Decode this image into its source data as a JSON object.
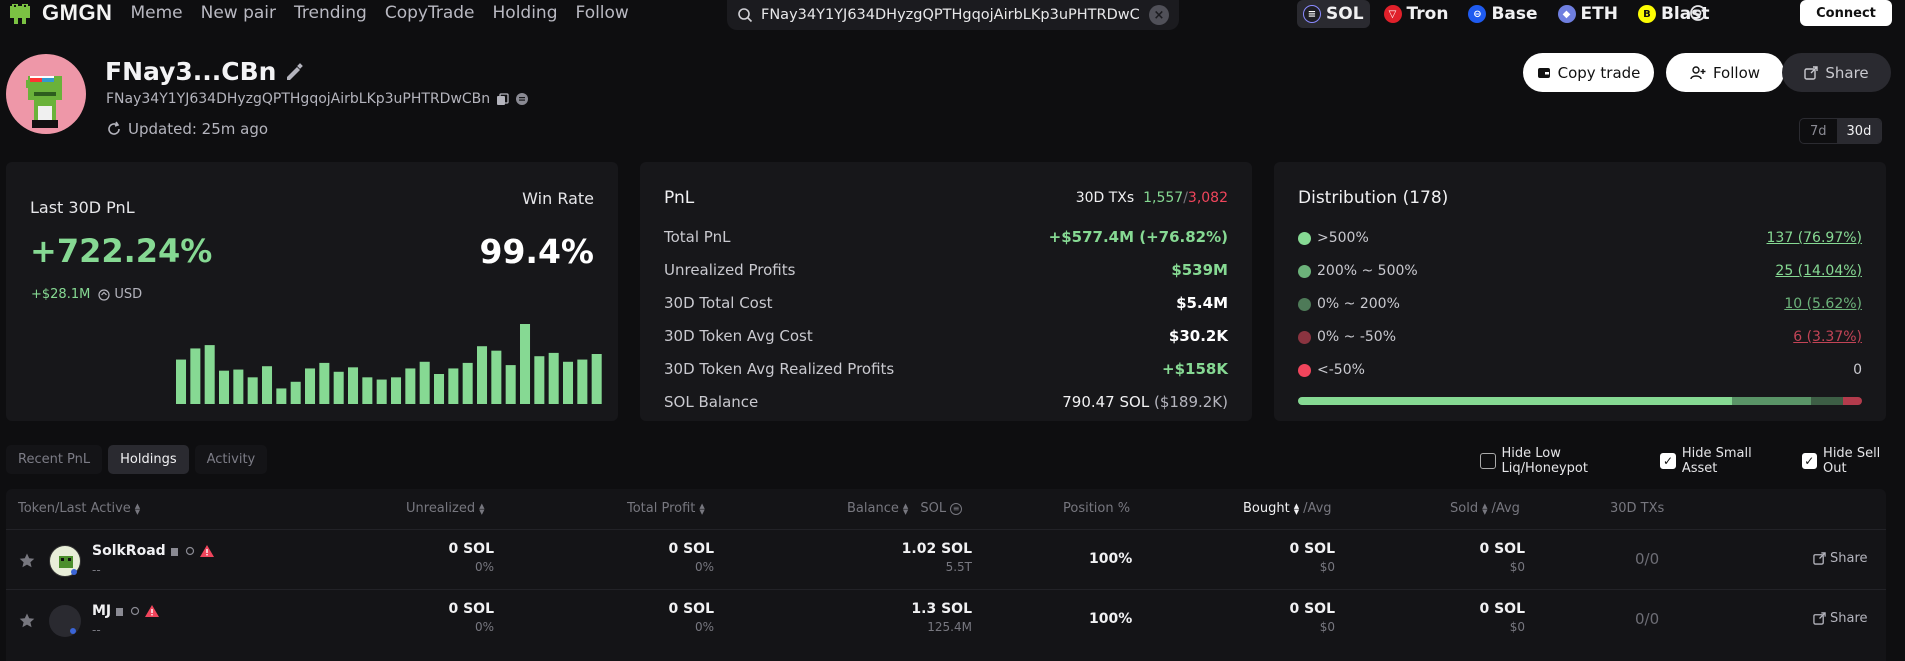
{
  "topbar": {
    "logo_text": "GMGN",
    "nav": [
      "Meme",
      "New pair",
      "Trending",
      "CopyTrade",
      "Holding",
      "Follow"
    ],
    "search_value": "FNay34Y1YJ634DHyzgQPTHgqojAirbLKp3uPHTRDwCBn",
    "chains": [
      {
        "label": "SOL",
        "color": "#1f1f24",
        "active": true
      },
      {
        "label": "Tron",
        "color": "#e0202a"
      },
      {
        "label": "Base",
        "color": "#1f5bf0"
      },
      {
        "label": "ETH",
        "color": "#6f7fe0"
      },
      {
        "label": "Blast",
        "color": "#fcfc03"
      }
    ],
    "connect_label": "Connect"
  },
  "wallet": {
    "name": "FNay3...CBn",
    "address": "FNay34Y1YJ634DHyzgQPTHgqojAirbLKp3uPHTRDwCBn",
    "updated": "Updated: 25m ago",
    "buttons": {
      "copy": "Copy trade",
      "follow": "Follow",
      "share": "Share"
    },
    "periods": [
      "7d",
      "30d"
    ],
    "period_active": "30d"
  },
  "pnl_card": {
    "label": "Last 30D PnL",
    "value": "+722.24%",
    "usd_value": "+$28.1M",
    "usd_label": "USD",
    "winrate_label": "Win Rate",
    "winrate_value": "99.4%",
    "bar_values": [
      40,
      50,
      53,
      30,
      31,
      24,
      34,
      14,
      20,
      32,
      37,
      29,
      33,
      24,
      22,
      24,
      32,
      38,
      27,
      32,
      37,
      52,
      48,
      35,
      72,
      43,
      46,
      38,
      40,
      45
    ]
  },
  "pnl_stats": {
    "title": "PnL",
    "tx_label": "30D TXs",
    "tx_buy": "1,557",
    "tx_sell": "3,082",
    "rows": [
      {
        "k": "Total PnL",
        "v": "+$577.4M (+76.82%)",
        "color": "#86d993"
      },
      {
        "k": "Unrealized Profits",
        "v": "$539M",
        "color": "#86d993"
      },
      {
        "k": "30D Total Cost",
        "v": "$5.4M",
        "color": "#ffffff"
      },
      {
        "k": "30D Token Avg Cost",
        "v": "$30.2K",
        "color": "#ffffff"
      },
      {
        "k": "30D Token Avg Realized Profits",
        "v": "+$158K",
        "color": "#86d993"
      },
      {
        "k": "SOL Balance",
        "v": "790.47 SOL",
        "v2": "($189.2K)",
        "color": "#ffffff"
      }
    ]
  },
  "distribution": {
    "title": "Distribution (178)",
    "rows": [
      {
        "k": ">500%",
        "v": "137 (76.97%)",
        "color": "#86d993",
        "vcolor": "#86d993"
      },
      {
        "k": "200% ~ 500%",
        "v": "25 (14.04%)",
        "color": "#6cb27a",
        "vcolor": "#86d993"
      },
      {
        "k": "0% ~ 200%",
        "v": "10 (5.62%)",
        "color": "#4e7a58",
        "vcolor": "#6cb27a"
      },
      {
        "k": "0% ~ -50%",
        "v": "6 (3.37%)",
        "color": "#8a3440",
        "vcolor": "#c24456"
      },
      {
        "k": "<-50%",
        "v": "0",
        "color": "#f0455c",
        "vcolor": "#c9c9cf"
      }
    ],
    "bar": [
      {
        "share": 0.7697,
        "color": "#86d993"
      },
      {
        "share": 0.1404,
        "color": "#5a9467"
      },
      {
        "share": 0.0562,
        "color": "#3d5e45"
      },
      {
        "share": 0.0337,
        "color": "#b33b4c"
      }
    ]
  },
  "tabs": [
    "Recent PnL",
    "Holdings",
    "Activity"
  ],
  "tab_active": "Holdings",
  "filters": [
    {
      "label": "Hide Low Liq/Honeypot",
      "checked": false
    },
    {
      "label": "Hide Small Asset",
      "checked": true
    },
    {
      "label": "Hide Sell Out",
      "checked": true
    }
  ],
  "table": {
    "headers": {
      "token": "Token/Last Active",
      "unrealized": "Unrealized",
      "total_profit": "Total Profit",
      "balance": "Balance",
      "balance_unit": "SOL",
      "position": "Position %",
      "bought": "Bought",
      "bought_avg": "/Avg",
      "sold": "Sold",
      "sold_avg": "/Avg",
      "txs": "30D TXs"
    },
    "rows": [
      {
        "name": "SolkRoad",
        "sub": "--",
        "unrealized": "0 SOL",
        "unrealized_pct": "0%",
        "profit": "0 SOL",
        "profit_pct": "0%",
        "balance": "1.02 SOL",
        "balance_sub": "5.5T",
        "position": "100%",
        "bought": "0 SOL",
        "bought_sub": "$0",
        "sold": "0 SOL",
        "sold_sub": "$0",
        "txs": "0/0",
        "share": "Share"
      },
      {
        "name": "MJ",
        "sub": "--",
        "unrealized": "0 SOL",
        "unrealized_pct": "0%",
        "profit": "0 SOL",
        "profit_pct": "0%",
        "balance": "1.3 SOL",
        "balance_sub": "125.4M",
        "position": "100%",
        "bought": "0 SOL",
        "bought_sub": "$0",
        "sold": "0 SOL",
        "sold_sub": "$0",
        "txs": "0/0",
        "share": "Share"
      }
    ]
  }
}
